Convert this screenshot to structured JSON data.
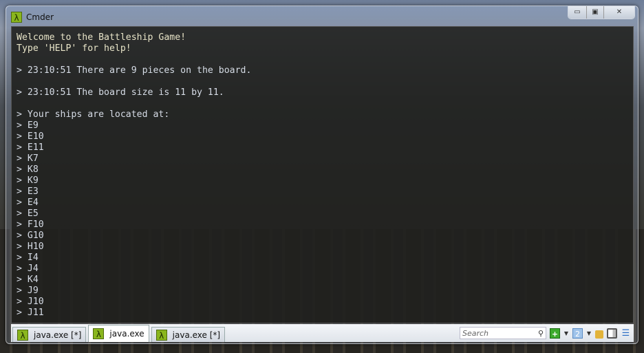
{
  "window": {
    "title": "Cmder",
    "app_icon": "lambda-icon",
    "controls": [
      "minimize",
      "maximize",
      "close"
    ]
  },
  "terminal": {
    "header": [
      "Welcome to the Battleship Game!",
      "Type 'HELP' for help!"
    ],
    "lines": [
      "",
      "> 23:10:51 There are 9 pieces on the board.",
      "",
      "> 23:10:51 The board size is 11 by 11.",
      "",
      "> Your ships are located at:",
      "> E9",
      "> E10",
      "> E11",
      "> K7",
      "> K8",
      "> K9",
      "> E3",
      "> E4",
      "> E5",
      "> F10",
      "> G10",
      "> H10",
      "> I4",
      "> J4",
      "> K4",
      "> J9",
      "> J10",
      "> J11"
    ]
  },
  "tabs": [
    {
      "label": "java.exe [*]",
      "active": false
    },
    {
      "label": "java.exe",
      "active": true
    },
    {
      "label": "java.exe [*]",
      "active": false
    }
  ],
  "toolbar": {
    "search_placeholder": "Search",
    "new_console_icon": "plus-icon",
    "console_number": "2",
    "icons": [
      "search-icon",
      "plus-icon",
      "dropdown-icon",
      "console-number-icon",
      "lock-icon",
      "split-view-icon",
      "menu-icon"
    ]
  }
}
